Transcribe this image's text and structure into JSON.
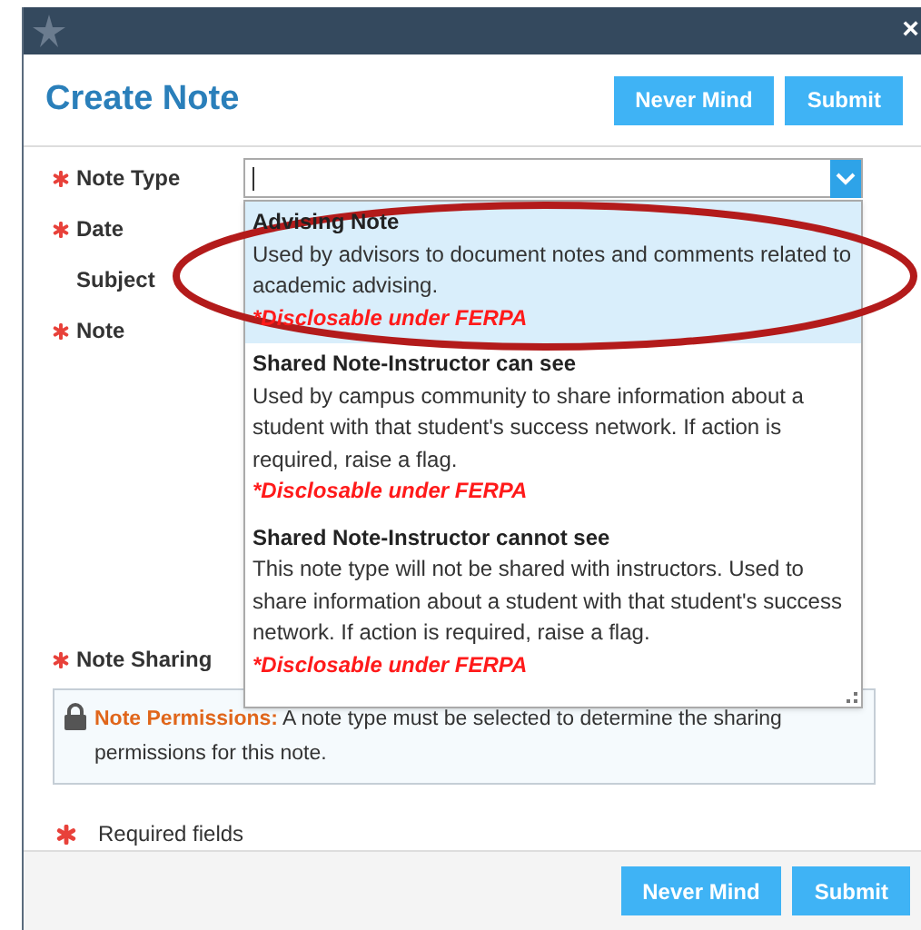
{
  "window": {
    "close": "×"
  },
  "header": {
    "title": "Create Note",
    "buttons": [
      "Never Mind",
      "Submit"
    ]
  },
  "fields": [
    {
      "label": "Note Type",
      "required": true
    },
    {
      "label": "Date",
      "required": true
    },
    {
      "label": "Subject",
      "required": false
    },
    {
      "label": "Note",
      "required": true
    },
    {
      "label": "Note Sharing",
      "required": true
    }
  ],
  "note_type_dropdown": {
    "expanded": true,
    "options": [
      {
        "title": "Advising Note",
        "description": "Used by advisors to document notes and comments related to academic advising.",
        "notice": "*Disclosable under FERPA",
        "selected": true
      },
      {
        "title": "Shared Note-Instructor can see",
        "description": "Used by campus community to share information about a student with that student's success network. If action is required, raise a flag.",
        "notice": "*Disclosable under FERPA",
        "selected": false
      },
      {
        "title": "Shared Note-Instructor cannot see",
        "description": "This note type will not be shared with instructors. Used to share information about a student with that student's success network. If action is required, raise a flag.",
        "notice": "*Disclosable under FERPA",
        "selected": false
      }
    ]
  },
  "permissions": {
    "label": "Note Permissions:",
    "text": "A note type must be selected to determine the sharing permissions for this note."
  },
  "required_legend": "Required fields",
  "footer": {
    "buttons": [
      "Never Mind",
      "Submit"
    ]
  }
}
